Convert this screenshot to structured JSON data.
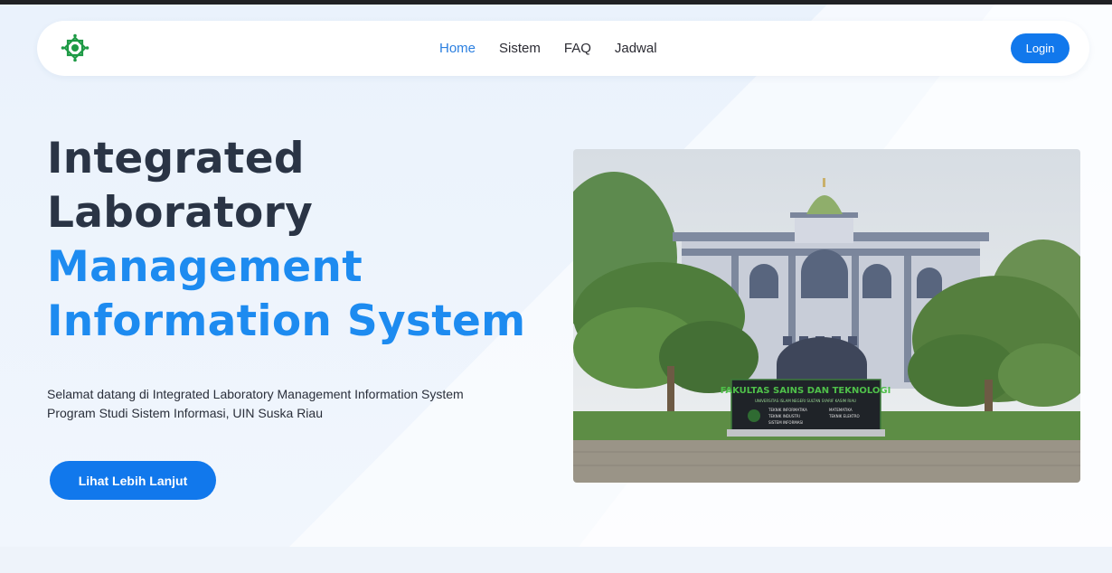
{
  "navbar": {
    "logo": {
      "icon": "uin-suska-logo-icon",
      "color": "#1e9a45"
    },
    "links": [
      {
        "label": "Home",
        "active": true
      },
      {
        "label": "Sistem",
        "active": false
      },
      {
        "label": "FAQ",
        "active": false
      },
      {
        "label": "Jadwal",
        "active": false
      }
    ],
    "login_label": "Login"
  },
  "hero": {
    "title_line1": "Integrated",
    "title_line2": "Laboratory",
    "title_line3": "Management",
    "title_line4": "Information System",
    "description_line1": "Selamat datang di Integrated Laboratory Management Information System",
    "description_line2": "Program Studi Sistem Informasi, UIN Suska Riau",
    "cta_label": "Lihat Lebih Lanjut",
    "image": {
      "sign_title": "FAKULTAS SAINS DAN TEKNOLOGI",
      "sign_subtitle": "UNIVERSITAS ISLAM NEGERI SULTAN SYARIF KASIM RIAU",
      "sign_items": [
        "TEKNIK INFORMATIKA",
        "MATEMATIKA",
        "TEKNIK INDUSTRI",
        "TEKNIK ELEKTRO",
        "SISTEM INFORMASI"
      ]
    }
  },
  "colors": {
    "accent": "#1178ec",
    "title_dark": "#2a3445",
    "title_blue": "#1d8bf0",
    "nav_active": "#2b7fe0"
  }
}
